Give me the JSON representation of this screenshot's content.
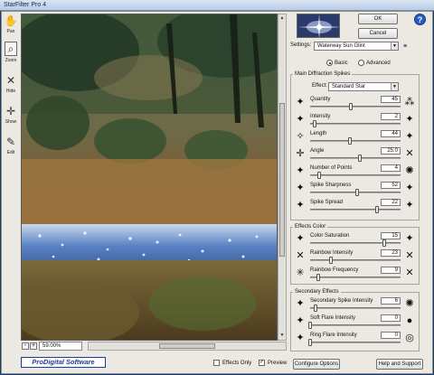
{
  "window": {
    "title": "StarFilter Pro 4"
  },
  "tools": [
    {
      "name": "pan",
      "label": "Pan",
      "glyph": "✋"
    },
    {
      "name": "zoom",
      "label": "Zoom",
      "glyph": "⌕"
    },
    {
      "name": "hide",
      "label": "Hide",
      "glyph": "✕"
    },
    {
      "name": "show",
      "label": "Show",
      "glyph": "✛"
    },
    {
      "name": "edit",
      "label": "Edit",
      "glyph": "✎"
    }
  ],
  "zoom": {
    "value": "59.00%",
    "minus": "-",
    "plus": "+"
  },
  "buttons": {
    "ok": "OK",
    "cancel": "Cancel",
    "help_icon": "?",
    "configure": "Configure Options",
    "help_support": "Help and Support"
  },
  "settings": {
    "label": "Settings:",
    "value": "Waterway Sun Glint",
    "menu_icon": "≡"
  },
  "mode": {
    "basic": "Basic",
    "advanced": "Advanced",
    "selected": "Basic"
  },
  "groups": {
    "main": "Main Diffraction Spikes",
    "color": "Effects Color",
    "secondary": "Secondary Effects"
  },
  "effect": {
    "label": "Effect:",
    "value": "Standard Star"
  },
  "sliders_main": [
    {
      "label": "Quantity",
      "value": "45",
      "fraction": 0.45,
      "licon": "✦",
      "ricon": "⁂"
    },
    {
      "label": "Intensity",
      "value": "2",
      "fraction": 0.05,
      "licon": "✦",
      "ricon": "✦"
    },
    {
      "label": "Length",
      "value": "44",
      "fraction": 0.44,
      "licon": "✧",
      "ricon": "✦"
    },
    {
      "label": "Angle",
      "value": "25.0",
      "fraction": 0.55,
      "licon": "✛",
      "ricon": "✕"
    },
    {
      "label": "Number of Points",
      "value": "4",
      "fraction": 0.1,
      "licon": "✦",
      "ricon": "✺"
    },
    {
      "label": "Spike Sharpness",
      "value": "52",
      "fraction": 0.52,
      "licon": "✦",
      "ricon": "✦"
    },
    {
      "label": "Spike Spread",
      "value": "22",
      "fraction": 0.74,
      "licon": "✦",
      "ricon": "✦"
    }
  ],
  "sliders_color": [
    {
      "label": "Color Saturation",
      "value": "15",
      "fraction": 0.82,
      "licon": "✦",
      "ricon": "✦"
    },
    {
      "label": "Rainbow Intensity",
      "value": "23",
      "fraction": 0.23,
      "licon": "✕",
      "ricon": "✕"
    },
    {
      "label": "Rainbow Frequency",
      "value": "9",
      "fraction": 0.09,
      "licon": "✳",
      "ricon": "✕"
    }
  ],
  "sliders_secondary": [
    {
      "label": "Secondary Spike Intensity",
      "value": "6",
      "fraction": 0.06,
      "licon": "✦",
      "ricon": "✺"
    },
    {
      "label": "Soft Flare Intensity",
      "value": "0",
      "fraction": 0.0,
      "licon": "✦",
      "ricon": "●"
    },
    {
      "label": "Ring Flare Intensity",
      "value": "0",
      "fraction": 0.0,
      "licon": "✦",
      "ricon": "◎"
    }
  ],
  "bottom": {
    "logo": "ProDigital Software",
    "effects_only": "Effects Only",
    "effects_only_checked": false,
    "preview": "Preview",
    "preview_checked": true,
    "check_mark": "✓"
  }
}
